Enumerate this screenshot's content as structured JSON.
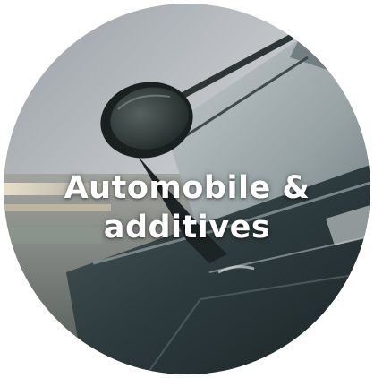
{
  "category": {
    "title_line1": "Automobile &",
    "title_line2": "additives",
    "image_subject": "car-side-mirror-image"
  },
  "colors": {
    "caption_text": "#ffffff",
    "background": "#ffffff"
  }
}
